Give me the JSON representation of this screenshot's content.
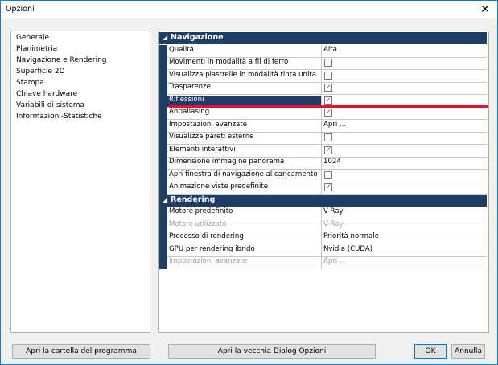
{
  "window": {
    "title": "Opzioni",
    "close_glyph": "✕"
  },
  "nav": {
    "items": [
      "Generale",
      "Planimetria",
      "Navigazione e Rendering",
      "Superficie 2D",
      "Stampa",
      "Chiave hardware",
      "Variabili di sistema",
      "Informazioni-Statistiche"
    ]
  },
  "grid": {
    "categories": [
      {
        "label": "Navigazione",
        "toggle": "◢",
        "rows": [
          {
            "name": "Qualità",
            "type": "text",
            "value": "Alta"
          },
          {
            "name": "Movimenti in modalità a fil di ferro",
            "type": "checkbox",
            "checked": false
          },
          {
            "name": "Visualizza piastrelle in modalità tinta unita",
            "type": "checkbox",
            "checked": false
          },
          {
            "name": "Trasparenze",
            "type": "checkbox",
            "checked": true
          },
          {
            "name": "Riflessioni",
            "type": "checkbox",
            "checked": true,
            "selected": true
          },
          {
            "name": "Antialiasing",
            "type": "checkbox",
            "checked": true
          },
          {
            "name": "Impostazioni avanzate",
            "type": "text",
            "value": "Apri ..."
          },
          {
            "name": "Visualizza pareti esterne",
            "type": "checkbox",
            "checked": false
          },
          {
            "name": "Elementi interattivi",
            "type": "checkbox",
            "checked": true
          },
          {
            "name": "Dimensione immagine panorama",
            "type": "text",
            "value": "1024"
          },
          {
            "name": "Apri finestra di navigazione al caricamento d",
            "type": "checkbox",
            "checked": false
          },
          {
            "name": "Animazione viste predefinite",
            "type": "checkbox",
            "checked": true
          }
        ]
      },
      {
        "label": "Rendering",
        "toggle": "◢",
        "rows": [
          {
            "name": "Motore predefinito",
            "type": "text",
            "value": "V-Ray"
          },
          {
            "name": "Motore utilizzato",
            "type": "text",
            "value": "V-Ray",
            "disabled": true
          },
          {
            "name": "Processo di rendering",
            "type": "text",
            "value": "Priorità normale"
          },
          {
            "name": "GPU per rendering ibrido",
            "type": "text",
            "value": "Nvidia (CUDA)"
          },
          {
            "name": "Impostazioni avanzate",
            "type": "text",
            "value": "Apri ...",
            "disabled": true
          }
        ]
      }
    ],
    "check_glyph": "✓"
  },
  "buttons": {
    "open_program_folder": "Apri la cartella del programma",
    "open_old_dialog": "Apri la vecchia Dialog Opzioni",
    "ok": "OK",
    "cancel": "Annulla"
  },
  "colors": {
    "accent": "#1f3e66",
    "annotation_line": "#e8112d"
  }
}
